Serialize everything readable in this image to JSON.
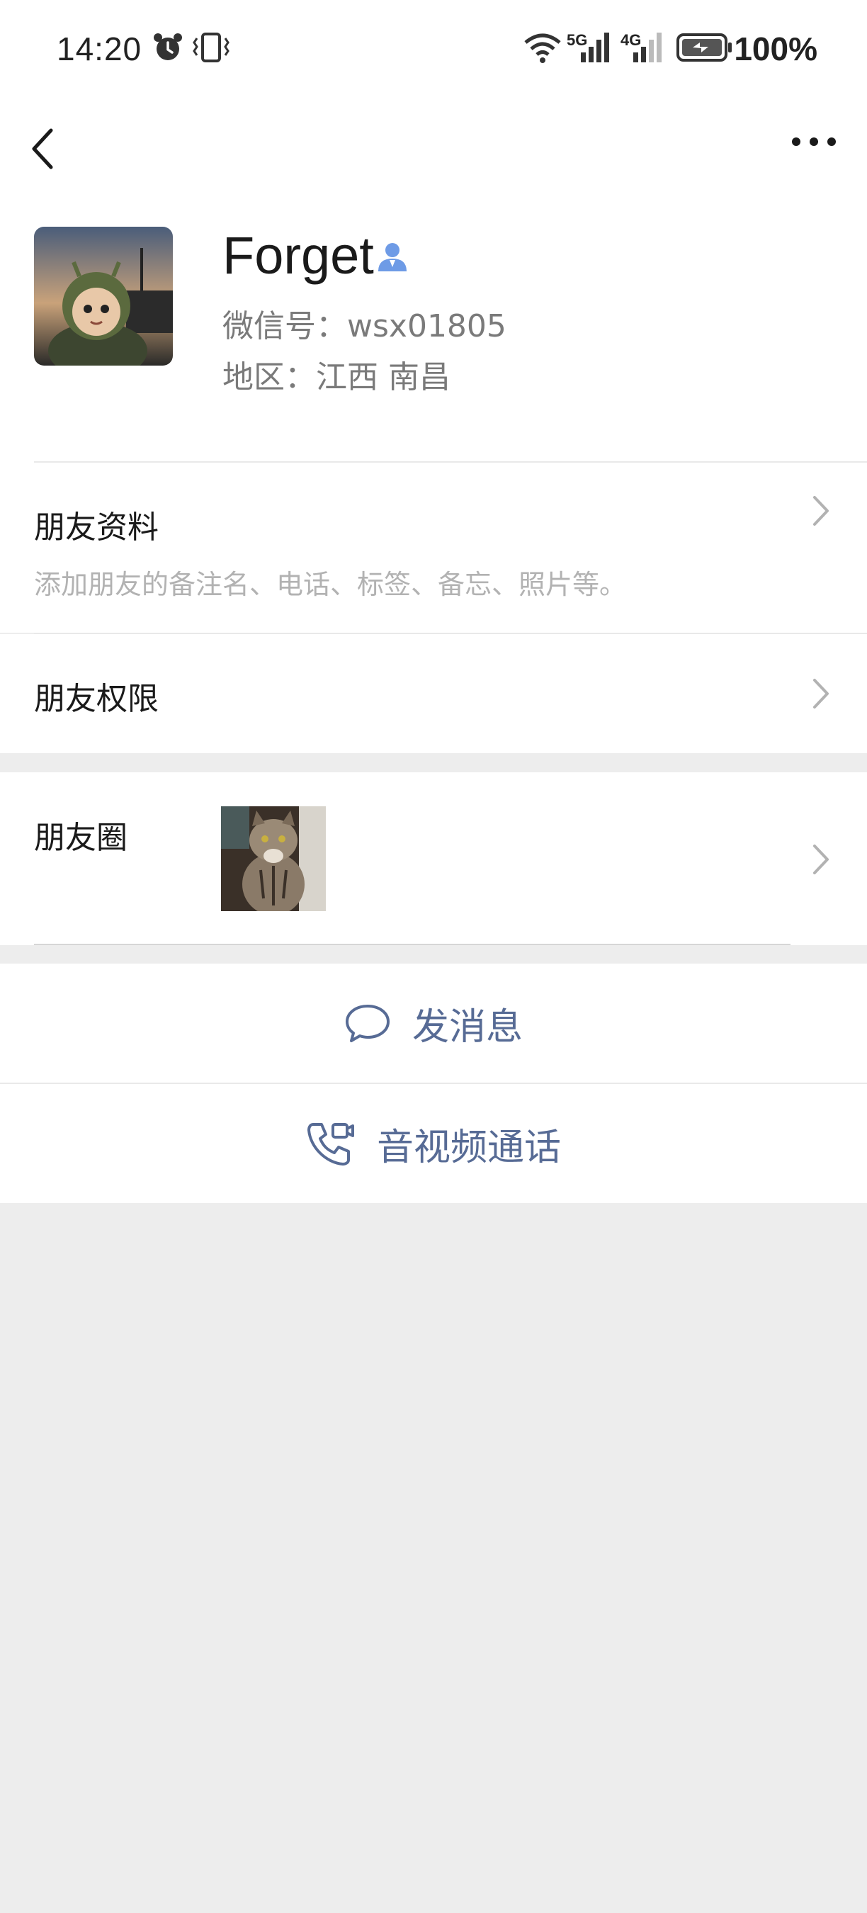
{
  "status_bar": {
    "time": "14:20",
    "net1": "5G",
    "net2": "4G",
    "battery": "100%"
  },
  "nav": {
    "back_icon": "back-chevron-icon",
    "more_icon": "more-dots-icon"
  },
  "profile": {
    "name": "Forget",
    "wechat_id": "微信号：wsx01805",
    "region": "地区：江西  南昌",
    "contact_icon": "person-icon",
    "contact_icon_color": "#6e9be6"
  },
  "rows": {
    "friend_info_title": "朋友资料",
    "friend_info_sub": "添加朋友的备注名、电话、标签、备忘、照片等。",
    "permissions_title": "朋友权限",
    "moments_title": "朋友圈"
  },
  "actions": {
    "message_label": "发消息",
    "call_label": "音视频通话",
    "accent": "#576b95"
  }
}
